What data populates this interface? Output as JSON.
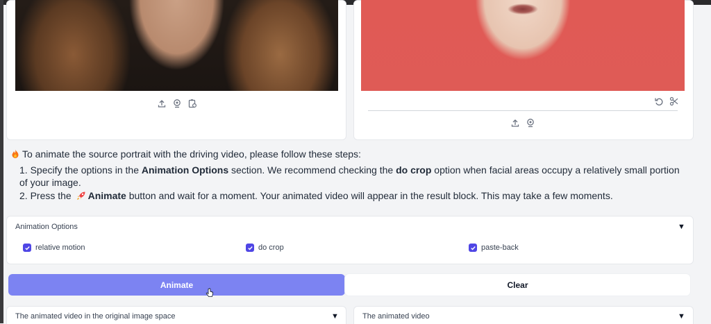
{
  "colors": {
    "accent": "#4f46e5",
    "animate_button": "#7c83f2"
  },
  "source_panel": {
    "icons": [
      "upload-icon",
      "webcam-icon",
      "clipboard-icon"
    ]
  },
  "driving_panel": {
    "top_icons": [
      "undo-icon",
      "scissors-icon"
    ],
    "bottom_icons": [
      "upload-icon",
      "webcam-icon"
    ]
  },
  "instructions": {
    "intro": "To animate the source portrait with the driving video, please follow these steps:",
    "step1_a": "1. Specify the options in the ",
    "step1_b": "Animation Options",
    "step1_c": " section. We recommend checking the ",
    "step1_d": "do crop",
    "step1_e": " option when facial areas occupy a relatively small portion of your image.",
    "step2_a": "2. Press the ",
    "step2_b": "Animate",
    "step2_c": " button and wait for a moment. Your animated video will appear in the result block. This may take a few moments."
  },
  "options": {
    "title": "Animation Options",
    "caret": "▼",
    "items": [
      {
        "label": "relative motion",
        "checked": true
      },
      {
        "label": "do crop",
        "checked": true
      },
      {
        "label": "paste-back",
        "checked": true
      }
    ]
  },
  "buttons": {
    "animate": "Animate",
    "clear": "Clear"
  },
  "results": [
    {
      "title": "The animated video in the original image space",
      "caret": "▼"
    },
    {
      "title": "The animated video",
      "caret": "▼"
    }
  ]
}
